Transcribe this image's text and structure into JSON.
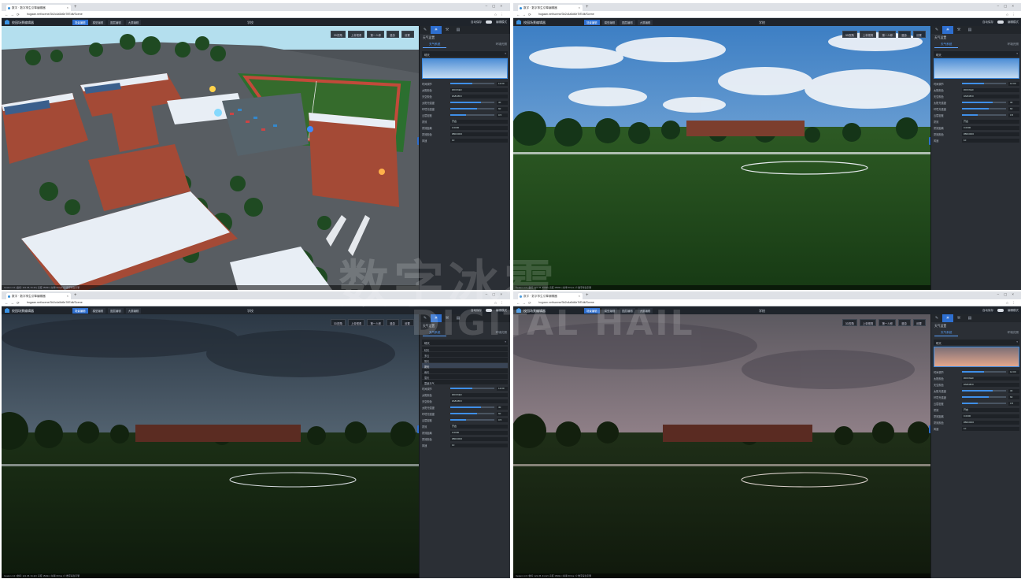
{
  "browser": {
    "tab_title": "数字 · 数字孪生引擎编辑器",
    "url": "hugaan.net/scene/3b2c4a5d6e7f/Edit/Scene"
  },
  "app": {
    "title": "校园场景编辑器",
    "center_title": "学校",
    "save_label": "自动保存",
    "header_right": "编辑模式",
    "mode_tabs": [
      "场景编辑",
      "模型编辑",
      "图层编辑",
      "大屏编辑"
    ]
  },
  "toolbar": {
    "items": [
      "3D视角",
      "上帝视角",
      "第一人称",
      "漫游",
      "设置"
    ]
  },
  "status_text": "Cesium 1.0 | 坐标: 121.45, 31.22 | 高度 1520m | 帧率 60 fps | © 数字孪生引擎",
  "panel": {
    "title": "天气设置",
    "subtab_active": "天气系统",
    "subtab_other": "环境光照",
    "dropdown_value": "晴天",
    "labels": {
      "time_of_day": "时间调节",
      "sun_color": "太阳颜色",
      "sky_color": "天空颜色",
      "sun_intensity": "太阳光强度",
      "ambient": "环境光强度",
      "cloud_density": "云层密度",
      "fog": "雾效",
      "fog_distance": "雾效距离",
      "fog_color": "雾效颜色",
      "wind": "风速"
    },
    "values": {
      "time": "12:00",
      "sun_hex": "#FFF6E0",
      "sky_hex": "#A8C8F0",
      "sun_level": "30",
      "ambient_level": "60",
      "cloud_level": "0.5",
      "fog_state": "开启",
      "fog_distance": "0.0000",
      "fog_color": "#B0C0D0",
      "wind": "10"
    },
    "weather_options": [
      "晴天",
      "多云",
      "阴天",
      "雾天",
      "雨天",
      "雪天",
      "雷暴天气"
    ],
    "highlighted_option": "雾天"
  },
  "watermark": {
    "cn": "数字冰雹",
    "en": "DIGITAL HAIL"
  },
  "colors": {
    "accent": "#2e6fd0",
    "header_bg": "#1f242b",
    "panel_bg": "#2b2f35"
  }
}
